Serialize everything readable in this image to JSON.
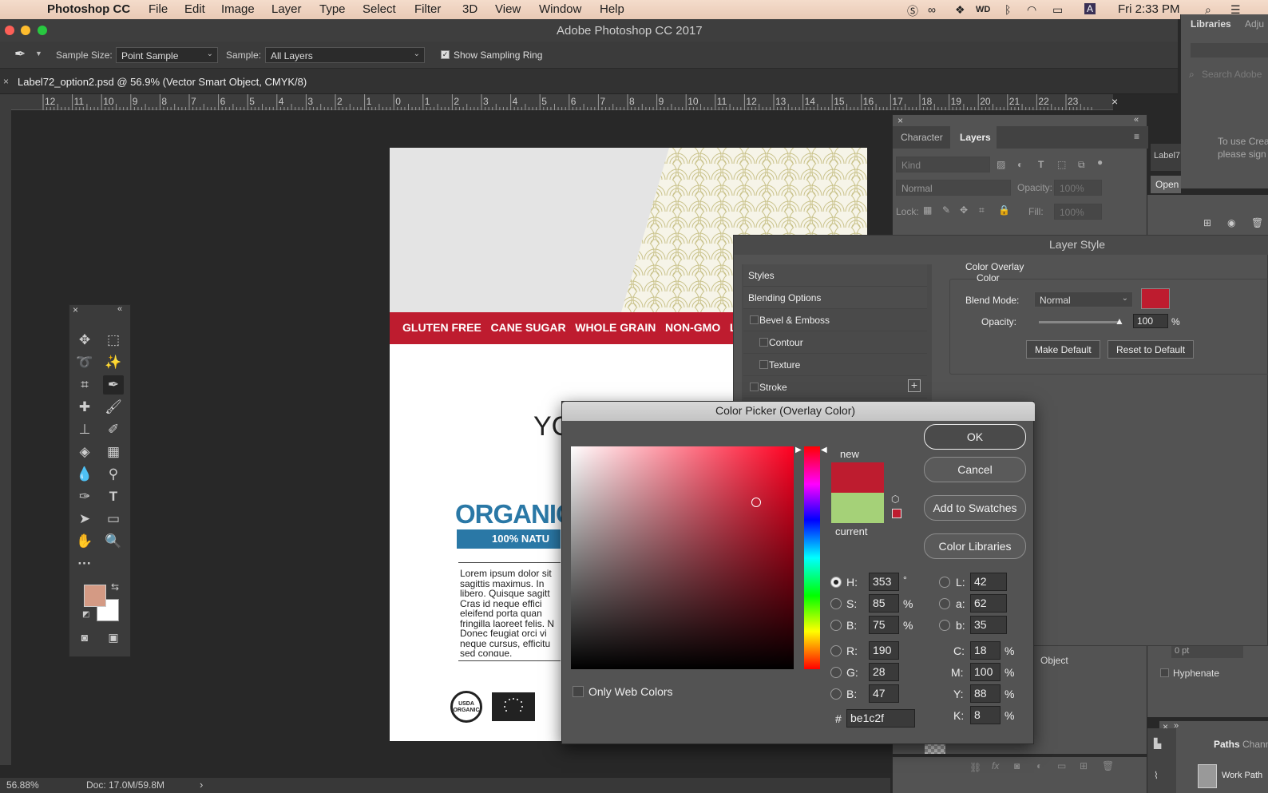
{
  "menubar": {
    "app_name": "Photoshop CC",
    "items": [
      "File",
      "Edit",
      "Image",
      "Layer",
      "Type",
      "Select",
      "Filter",
      "3D",
      "View",
      "Window",
      "Help"
    ],
    "clock": "Fri 2:33 PM"
  },
  "window": {
    "title": "Adobe Photoshop CC 2017"
  },
  "options": {
    "sample_size_label": "Sample Size:",
    "sample_size_value": "Point Sample",
    "sample_label": "Sample:",
    "sample_value": "All Layers",
    "show_ring_label": "Show Sampling Ring"
  },
  "document": {
    "tab_title": "Label72_option2.psd @ 56.9% (Vector Smart Object, CMYK/8)",
    "ruler_ticks": [
      "12",
      "11",
      "10",
      "9",
      "8",
      "7",
      "6",
      "5",
      "4",
      "3",
      "2",
      "1",
      "0",
      "1",
      "2",
      "3",
      "4",
      "5",
      "6",
      "7",
      "8",
      "9",
      "10",
      "11",
      "12",
      "13",
      "14",
      "15",
      "16",
      "17",
      "18",
      "19",
      "20",
      "21",
      "22",
      "23"
    ]
  },
  "canvas": {
    "banner_text": "GLUTEN FREE   CANE SUGAR   WHOLE GRAIN   NON-GMO   LOW",
    "y_text": "YC",
    "organic_heading": "ORGANIC",
    "organic_sub": "100% NATU",
    "lorem": "Lorem ipsum dolor sit sagittis maximus. In libero. Quisque sagitt Cras id neque effici eleifend porta quan fringilla laoreet felis. N Donec feugiat orci vi neque cursus, efficitu sed congue.",
    "usda_text": "USDA ORGANIC"
  },
  "status": {
    "zoom": "56.88%",
    "doc": "Doc: 17.0M/59.8M"
  },
  "panels": {
    "libraries_tab": "Libraries",
    "adjustments_tab": "Adju",
    "search_placeholder": "Search Adobe",
    "libraries_msg_1": "To use Crea",
    "libraries_msg_2": "please sign",
    "label_thumb": "Label7",
    "open_button": "Open",
    "character_tab": "Character",
    "layers_tab": "Layers",
    "kind_label": "Kind",
    "blend_mode": "Normal",
    "opacity_label": "Opacity:",
    "opacity_value": "100%",
    "lock_label": "Lock:",
    "fill_label": "Fill:",
    "fill_value": "100%",
    "object_label": "Object",
    "hyphenate_label": "Hyphenate",
    "pt_value": "0 pt",
    "paths_tab": "Paths",
    "channels_tab": "Chann",
    "work_path": "Work Path"
  },
  "layer_style": {
    "title": "Layer Style",
    "items": [
      "Styles",
      "Blending Options",
      "Bevel & Emboss",
      "Contour",
      "Texture",
      "Stroke"
    ],
    "group_title": "Color Overlay",
    "sub_title": "Color",
    "blend_mode_label": "Blend Mode:",
    "blend_mode_value": "Normal",
    "opacity_label": "Opacity:",
    "opacity_value": "100",
    "percent": "%",
    "make_default": "Make Default",
    "reset_default": "Reset to Default",
    "overlay_color": "#be1c2f"
  },
  "color_picker": {
    "title": "Color Picker (Overlay Color)",
    "ok": "OK",
    "cancel": "Cancel",
    "add_swatches": "Add to Swatches",
    "color_libraries": "Color Libraries",
    "new_label": "new",
    "current_label": "current",
    "new_color": "#be1c2f",
    "current_color": "#a5d178",
    "only_web": "Only Web Colors",
    "fields": {
      "H": {
        "label": "H:",
        "value": "353",
        "unit": "°"
      },
      "S": {
        "label": "S:",
        "value": "85",
        "unit": "%"
      },
      "Bv": {
        "label": "B:",
        "value": "75",
        "unit": "%"
      },
      "R": {
        "label": "R:",
        "value": "190"
      },
      "G": {
        "label": "G:",
        "value": "28"
      },
      "Bb": {
        "label": "B:",
        "value": "47"
      },
      "L": {
        "label": "L:",
        "value": "42"
      },
      "a": {
        "label": "a:",
        "value": "62"
      },
      "b": {
        "label": "b:",
        "value": "35"
      },
      "C": {
        "label": "C:",
        "value": "18",
        "unit": "%"
      },
      "M": {
        "label": "M:",
        "value": "100",
        "unit": "%"
      },
      "Y": {
        "label": "Y:",
        "value": "88",
        "unit": "%"
      },
      "K": {
        "label": "K:",
        "value": "8",
        "unit": "%"
      }
    },
    "hash": "#",
    "hex": "be1c2f"
  },
  "toolbox": {
    "foreground": "#d49a84",
    "background": "#ffffff"
  }
}
